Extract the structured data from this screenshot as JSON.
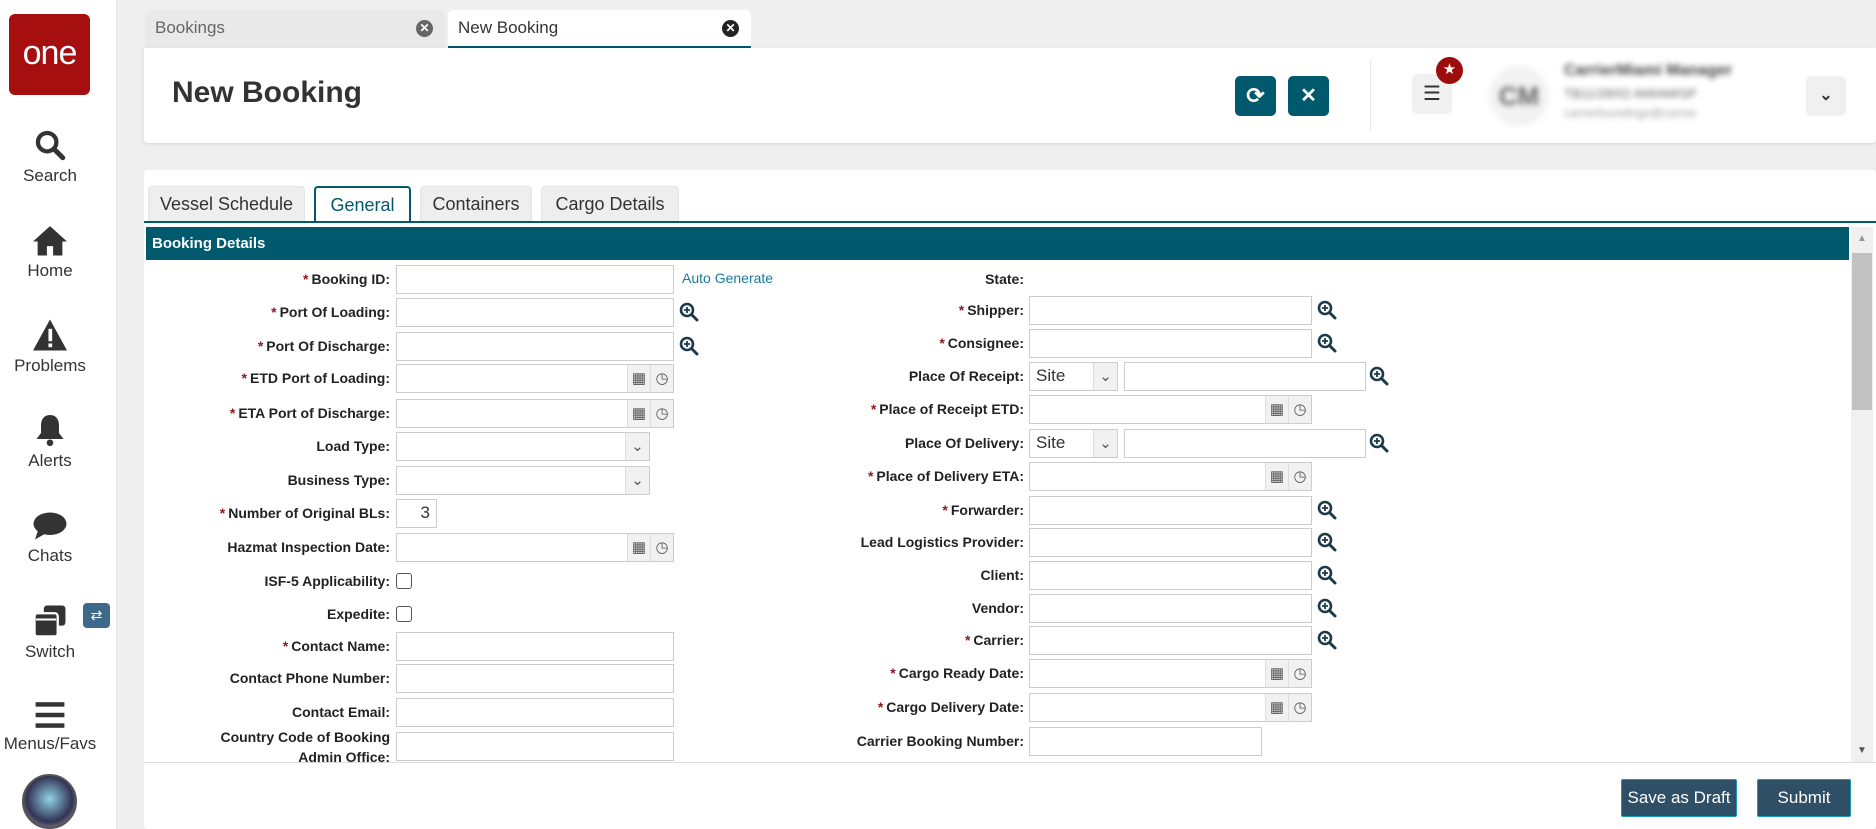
{
  "sidebar": {
    "logo": "one",
    "items": [
      {
        "label": "Search",
        "icon": "search-icon"
      },
      {
        "label": "Home",
        "icon": "home-icon"
      },
      {
        "label": "Problems",
        "icon": "warning-icon"
      },
      {
        "label": "Alerts",
        "icon": "bell-icon"
      },
      {
        "label": "Chats",
        "icon": "chat-icon"
      },
      {
        "label": "Switch",
        "icon": "switch-icon"
      },
      {
        "label": "Menus/Favs",
        "icon": "menu-icon"
      }
    ]
  },
  "tabs": [
    {
      "label": "Bookings",
      "active": false
    },
    {
      "label": "New Booking",
      "active": true
    }
  ],
  "header": {
    "title": "New Booking",
    "user_initials": "CM",
    "user_name": "CarrierMiami Manager",
    "user_org": "TB11/28/02 AMIAMISP",
    "user_email": "carrierfoundinge@carrier"
  },
  "form_tabs": [
    "Vessel Schedule",
    "General",
    "Containers",
    "Cargo Details"
  ],
  "active_form_tab": "General",
  "section_title": "Booking Details",
  "left_fields": [
    {
      "label": "Booking ID:",
      "required": true,
      "type": "text",
      "link": "Auto Generate"
    },
    {
      "label": "Port Of Loading:",
      "required": true,
      "type": "lookup"
    },
    {
      "label": "Port Of Discharge:",
      "required": true,
      "type": "lookup"
    },
    {
      "label": "ETD Port of Loading:",
      "required": true,
      "type": "date"
    },
    {
      "label": "ETA Port of Discharge:",
      "required": true,
      "type": "date"
    },
    {
      "label": "Load Type:",
      "required": false,
      "type": "select"
    },
    {
      "label": "Business Type:",
      "required": false,
      "type": "select"
    },
    {
      "label": "Number of Original BLs:",
      "required": true,
      "type": "number",
      "value": "3"
    },
    {
      "label": "Hazmat Inspection Date:",
      "required": false,
      "type": "date"
    },
    {
      "label": "ISF-5 Applicability:",
      "required": false,
      "type": "checkbox"
    },
    {
      "label": "Expedite:",
      "required": false,
      "type": "checkbox"
    },
    {
      "label": "Contact Name:",
      "required": true,
      "type": "text"
    },
    {
      "label": "Contact Phone Number:",
      "required": false,
      "type": "text"
    },
    {
      "label": "Contact Email:",
      "required": false,
      "type": "text"
    },
    {
      "label": "Country Code of Booking Admin Office:",
      "required": false,
      "type": "text",
      "multiline": true
    }
  ],
  "right_fields": [
    {
      "label": "State:",
      "required": false,
      "type": "none"
    },
    {
      "label": "Shipper:",
      "required": true,
      "type": "lookup"
    },
    {
      "label": "Consignee:",
      "required": true,
      "type": "lookup"
    },
    {
      "label": "Place Of Receipt:",
      "required": false,
      "type": "site",
      "value": "Site"
    },
    {
      "label": "Place of Receipt ETD:",
      "required": true,
      "type": "date"
    },
    {
      "label": "Place Of Delivery:",
      "required": false,
      "type": "site",
      "value": "Site"
    },
    {
      "label": "Place of Delivery ETA:",
      "required": true,
      "type": "date"
    },
    {
      "label": "Forwarder:",
      "required": true,
      "type": "lookup"
    },
    {
      "label": "Lead Logistics Provider:",
      "required": false,
      "type": "lookup"
    },
    {
      "label": "Client:",
      "required": false,
      "type": "lookup"
    },
    {
      "label": "Vendor:",
      "required": false,
      "type": "lookup"
    },
    {
      "label": "Carrier:",
      "required": true,
      "type": "lookup"
    },
    {
      "label": "Cargo Ready Date:",
      "required": true,
      "type": "date"
    },
    {
      "label": "Cargo Delivery Date:",
      "required": true,
      "type": "date"
    },
    {
      "label": "Carrier Booking Number:",
      "required": false,
      "type": "short"
    }
  ],
  "footer": {
    "save_draft": "Save as Draft",
    "submit": "Submit"
  },
  "colors": {
    "brand": "#a50f0f",
    "accent": "#00596d",
    "button": "#2e4f66"
  }
}
